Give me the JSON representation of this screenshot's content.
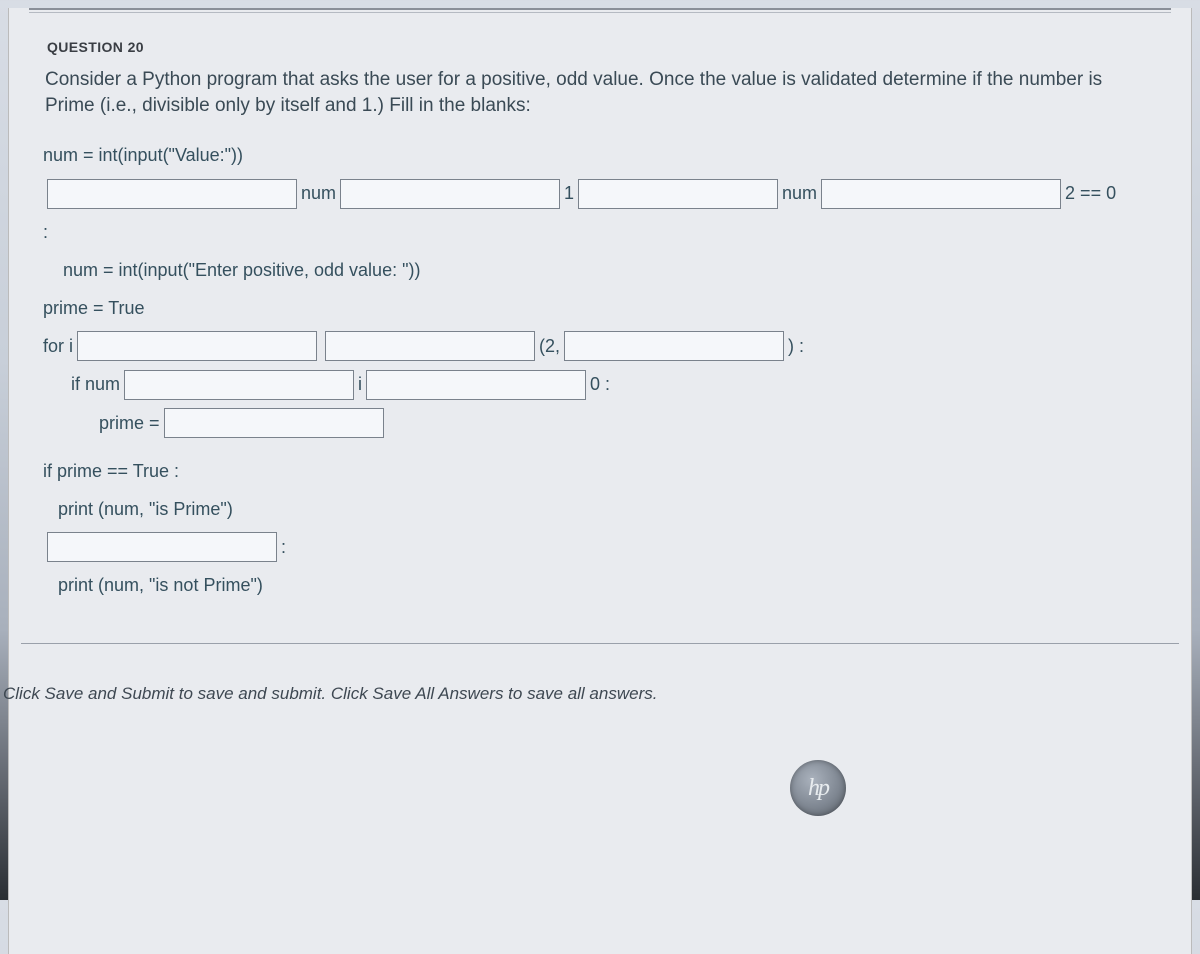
{
  "header": {
    "question_label": "QUESTION 20"
  },
  "prompt": "Consider a Python program that asks the user for a positive, odd value.  Once the value is validated determine if the number is Prime (i.e., divisible only by itself and 1.)  Fill in the blanks:",
  "code": {
    "l1": "num = int(input(\"Value:\"))",
    "l2_a": "num",
    "l2_b": "1",
    "l2_c": "num",
    "l2_d": "2 == 0",
    "l3_a": ":",
    "l4": "    num = int(input(\"Enter positive, odd value: \"))",
    "l5": "prime = True",
    "l6_a": "for i",
    "l6_b": "(2,",
    "l6_c": ") :",
    "l7_a": "if num",
    "l7_b": "i",
    "l7_c": "0 :",
    "l8_a": "prime =",
    "l9": "if prime == True :",
    "l10": "   print (num, \"is Prime\")",
    "l11_a": ":",
    "l12": "   print (num, \"is not Prime\")"
  },
  "footer": "Click Save and Submit to save and submit. Click Save All Answers to save all answers.",
  "logo": "hp"
}
